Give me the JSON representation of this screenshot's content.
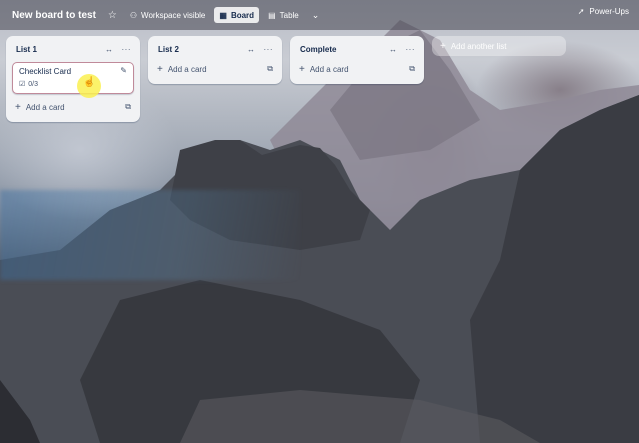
{
  "header": {
    "board_title": "New board to test",
    "visibility_label": "Workspace visible",
    "view_board_label": "Board",
    "view_table_label": "Table",
    "powerups_label": "Power-Ups"
  },
  "lists": [
    {
      "title": "List 1",
      "cards": [
        {
          "title": "Checklist Card",
          "checklist": "0/3"
        }
      ],
      "add_card_label": "Add a card"
    },
    {
      "title": "List 2",
      "cards": [],
      "add_card_label": "Add a card"
    },
    {
      "title": "Complete",
      "cards": [],
      "add_card_label": "Add a card"
    }
  ],
  "add_list_label": "Add another list",
  "colors": {
    "list_bg": "#f1f2f4",
    "text": "#172b4d",
    "header_bg": "#46464f"
  }
}
